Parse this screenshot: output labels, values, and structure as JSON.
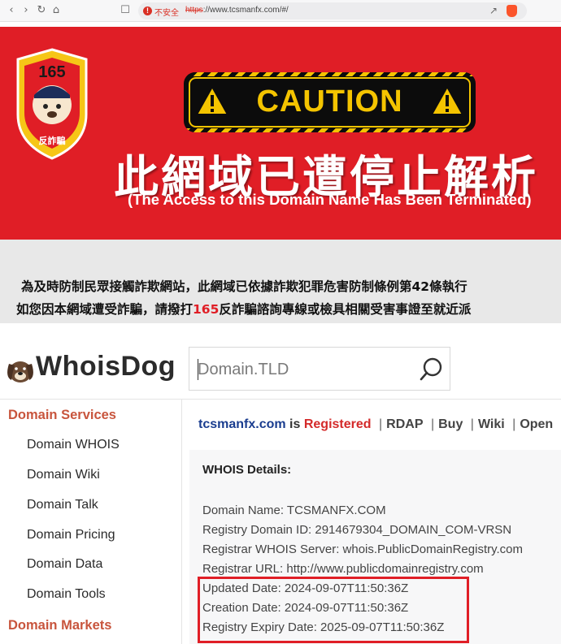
{
  "browser": {
    "insecure_label": "不安全",
    "url_scheme": "https",
    "url_rest": "://www.tcsmanfx.com/#/",
    "nav_icons": [
      "back-icon",
      "forward-icon",
      "reload-icon",
      "home-icon",
      "bookmark-icon"
    ]
  },
  "banner": {
    "badge_number": "165",
    "badge_label": "反詐騙",
    "caution": "CAUTION",
    "title_zh": "此網域已遭停止解析",
    "title_en": "(The Access to this Domain Name Has Been Terminated)",
    "colors": {
      "background": "#e01e26",
      "caution_yellow": "#f4c400"
    }
  },
  "notice": {
    "line1": "為及時防制民眾接觸詐欺網站，此網域已依據詐欺犯罪危害防制條例第42條執行",
    "line2_a": "如您因本網域遭受詐騙，請撥打",
    "line2_hotline": "165",
    "line2_b": "反詐騙諮詢專線或檢具相關受害事證至就近派"
  },
  "whoisdog": {
    "logo": "WhoisDog",
    "search": {
      "placeholder": "Domain.TLD",
      "value": ""
    },
    "sidebar": {
      "heading": "Domain Services",
      "items": [
        "Domain WHOIS",
        "Domain Wiki",
        "Domain Talk",
        "Domain Pricing",
        "Domain Data",
        "Domain Tools"
      ],
      "heading2": "Domain Markets"
    },
    "status_line": {
      "domain": "tcsmanfx.com",
      "is": "is",
      "status": "Registered",
      "links": [
        "RDAP",
        "Buy",
        "Wiki",
        "Open"
      ]
    },
    "details": {
      "title": "WHOIS Details:",
      "rows": [
        "Domain Name: TCSMANFX.COM",
        "Registry Domain ID: 2914679304_DOMAIN_COM-VRSN",
        "Registrar WHOIS Server: whois.PublicDomainRegistry.com",
        "Registrar URL: http://www.publicdomainregistry.com",
        "Updated Date: 2024-09-07T11:50:36Z",
        "Creation Date: 2024-09-07T11:50:36Z",
        "Registry Expiry Date: 2025-09-07T11:50:36Z"
      ]
    }
  }
}
